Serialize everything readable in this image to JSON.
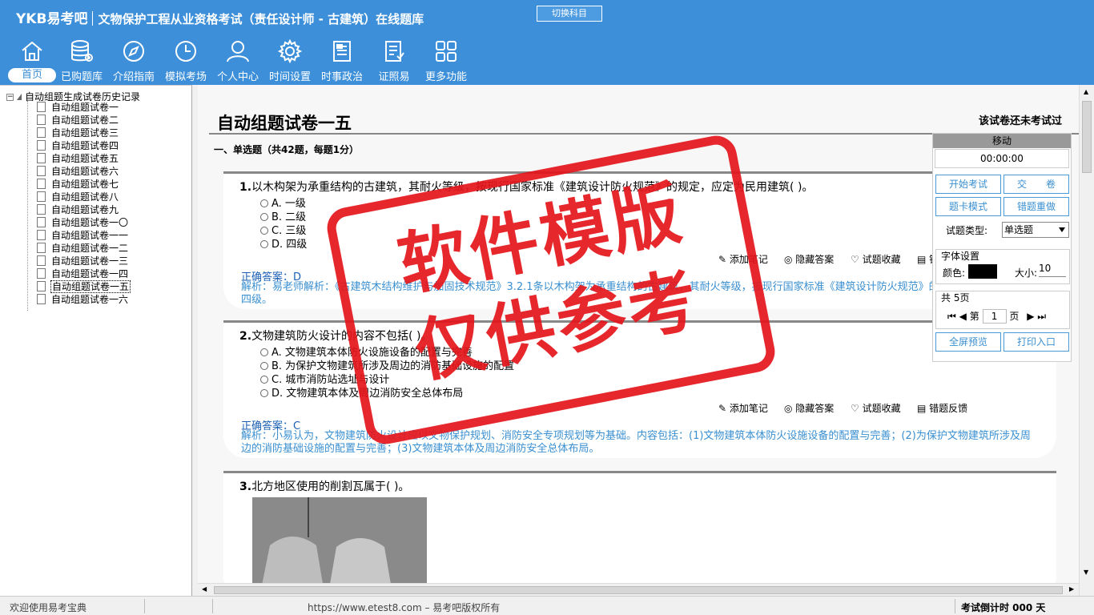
{
  "header": {
    "brand": "YKB易考吧",
    "exam_title": "文物保护工程从业资格考试（责任设计师 - 古建筑）在线题库",
    "switch_label": "切换科目",
    "nav": [
      {
        "label": "首页",
        "icon": "home-icon"
      },
      {
        "label": "已购题库",
        "icon": "database-icon"
      },
      {
        "label": "介绍指南",
        "icon": "compass-icon"
      },
      {
        "label": "模拟考场",
        "icon": "clock-icon"
      },
      {
        "label": "个人中心",
        "icon": "user-icon"
      },
      {
        "label": "时间设置",
        "icon": "gear-icon"
      },
      {
        "label": "时事政治",
        "icon": "news-icon"
      },
      {
        "label": "证照易",
        "icon": "certificate-icon"
      },
      {
        "label": "更多功能",
        "icon": "grid-icon"
      }
    ]
  },
  "tree": {
    "root": "自动组题生成试卷历史记录",
    "items": [
      "自动组题试卷一",
      "自动组题试卷二",
      "自动组题试卷三",
      "自动组题试卷四",
      "自动组题试卷五",
      "自动组题试卷六",
      "自动组题试卷七",
      "自动组题试卷八",
      "自动组题试卷九",
      "自动组题试卷一〇",
      "自动组题试卷一一",
      "自动组题试卷一二",
      "自动组题试卷一三",
      "自动组题试卷一四",
      "自动组题试卷一五",
      "自动组题试卷一六"
    ],
    "selected_index": 14
  },
  "main": {
    "title": "自动组题试卷一五",
    "status": "该试卷还未考试过",
    "section": "一、单选题（共42题，每题1分）",
    "tools": {
      "note": "添加笔记",
      "hide": "隐藏答案",
      "fav": "试题收藏",
      "feedback": "错题反馈"
    },
    "questions": [
      {
        "num": "1.",
        "text": "以木构架为承重结构的古建筑，其耐火等级，按现行国家标准《建筑设计防火规范》的规定，应定为民用建筑(  )。",
        "options": [
          "A. 一级",
          "B. 二级",
          "C. 三级",
          "D. 四级"
        ],
        "answer": "正确答案：D",
        "analysis": "解析：易老师解析：《古建筑木结构维护与加固技术规范》3.2.1条以木构架为承重结构的古建筑，其耐火等级，按现行国家标准《建筑设计防火规范》的规定，定为民用建筑四级。"
      },
      {
        "num": "2.",
        "text": "文物建筑防火设计的内容不包括(  )。",
        "options": [
          "A. 文物建筑本体防火设施设备的配置与完善",
          "B. 为保护文物建筑所涉及周边的消防基础设施的配置",
          "C. 城市消防站选址与设计",
          "D. 文物建筑本体及周边消防安全总体布局"
        ],
        "answer": "正确答案：C",
        "analysis": "解析：小易认为，文物建筑防火设计应以文物保护规划、消防安全专项规划等为基础。内容包括：(1)文物建筑本体防火设施设备的配置与完善；(2)为保护文物建筑所涉及周边的消防基础设施的配置与完善；(3)文物建筑本体及周边消防安全总体布局。"
      },
      {
        "num": "3.",
        "text": "北方地区使用的削割瓦属于(  )。"
      }
    ]
  },
  "panel": {
    "move": "移动",
    "timer": "00:00:00",
    "start": "开始考试",
    "submit": "交　　卷",
    "card_mode": "题卡模式",
    "redo_wrong": "错题重做",
    "type_label": "试题类型:",
    "type_value": "单选题",
    "font_group": "字体设置",
    "color_label": "颜色:",
    "size_label": "大小:",
    "size_value": "10",
    "pages_label": "共 5页",
    "page_prefix": "第",
    "page_value": "1",
    "page_suffix": "页",
    "preview": "全屏预览",
    "print": "打印入口",
    "font_color": "#000000"
  },
  "stamp": {
    "line1": "软件模版",
    "line2": "仅供参考"
  },
  "status": {
    "welcome": "欢迎使用易考宝典",
    "url": "https://www.etest8.com – 易考吧版权所有",
    "countdown": "考试倒计时 000 天"
  },
  "colors": {
    "header": "#3c8fd8",
    "answer": "#1a5fb4",
    "analysis": "#3a8fd0",
    "stamp": "#e4161c"
  }
}
